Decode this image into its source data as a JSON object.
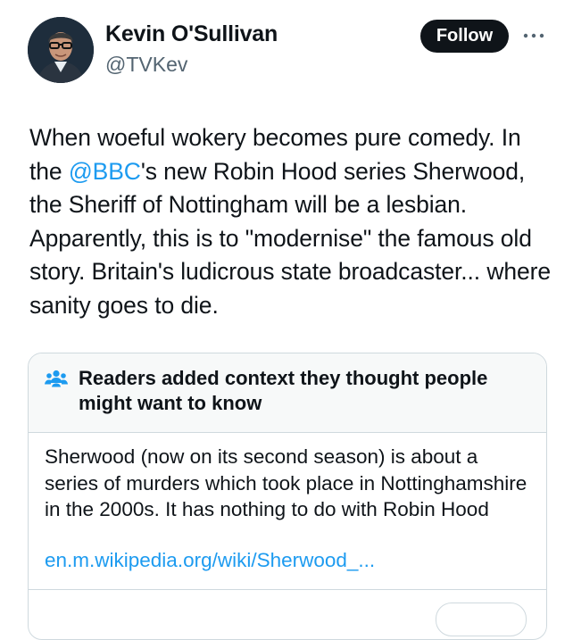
{
  "author": {
    "display_name": "Kevin O'Sullivan",
    "handle": "@TVKev"
  },
  "actions": {
    "follow_label": "Follow",
    "more_icon": "more-horizontal-icon"
  },
  "tweet": {
    "text_before_mention": "When woeful wokery becomes pure comedy. In the ",
    "mention": "@BBC",
    "text_after_mention": "'s new Robin Hood series Sherwood, the Sheriff of Nottingham will be a lesbian. Apparently, this is to \"modernise\" the famous old story. Britain's ludicrous state broadcaster... where sanity goes to die."
  },
  "community_note": {
    "icon": "people-icon",
    "title": "Readers added context they thought people might want to know",
    "body": "Sherwood (now on its second season) is about a series of murders which took place in Nottinghamshire in the 2000s. It has nothing to do with Robin Hood",
    "link": "en.m.wikipedia.org/wiki/Sherwood_..."
  },
  "colors": {
    "link": "#1d9bf0",
    "text": "#0f1419",
    "secondary": "#536471",
    "border": "#cfd9de",
    "note_header_bg": "#f7f9f9",
    "follow_bg": "#0f1419"
  }
}
